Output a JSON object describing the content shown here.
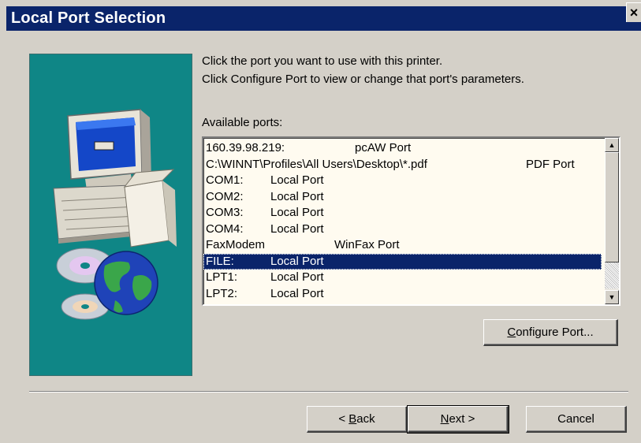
{
  "window": {
    "title": "Local Port Selection",
    "close_glyph": "×"
  },
  "instructions": {
    "line1": "Click the port you want to use with this printer.",
    "line2": "Click Configure Port to view or change that port's parameters."
  },
  "ports_label": "Available ports:",
  "ports": [
    {
      "name": "160.39.98.219:",
      "desc": "pcAW Port"
    },
    {
      "name": "C:\\WINNT\\Profiles\\All Users\\Desktop\\*.pdf",
      "desc": "PDF Port"
    },
    {
      "name": "COM1:",
      "desc": "Local Port"
    },
    {
      "name": "COM2:",
      "desc": "Local Port"
    },
    {
      "name": "COM3:",
      "desc": "Local Port"
    },
    {
      "name": "COM4:",
      "desc": "Local Port"
    },
    {
      "name": "FaxModem",
      "desc": "WinFax Port"
    },
    {
      "name": "FILE:",
      "desc": "Local Port",
      "selected": true
    },
    {
      "name": "LPT1:",
      "desc": "Local Port"
    },
    {
      "name": "LPT2:",
      "desc": "Local Port"
    }
  ],
  "buttons": {
    "configure": {
      "pre": "",
      "key": "C",
      "post": "onfigure Port..."
    },
    "back": {
      "arrow": "< ",
      "key": "B",
      "post": "ack"
    },
    "next": {
      "pre": "",
      "key": "N",
      "post": "ext >"
    },
    "cancel": "Cancel"
  },
  "icons": {
    "scroll_up": "▲",
    "scroll_down": "▼",
    "illustration": "computer-globe-cd-illustration"
  },
  "colors": {
    "titlebar": "#0a246a",
    "selection": "#0a246a",
    "art_background": "#0f8686",
    "dialog_face": "#d4d0c8"
  }
}
